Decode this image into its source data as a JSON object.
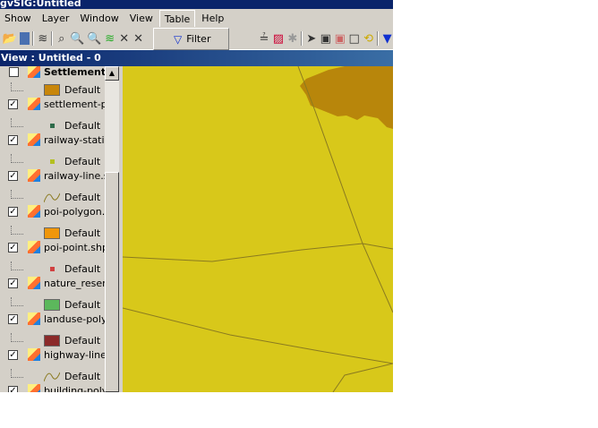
{
  "window": {
    "title": "gvSIG:Untitled"
  },
  "menu": [
    "Show",
    "Layer",
    "Window",
    "View",
    "Table",
    "Help"
  ],
  "dropdown": {
    "item": "Filter"
  },
  "view": {
    "title": "View : Untitled - 0"
  },
  "toc": {
    "top_partial": "Settlement",
    "legend_label": "Default",
    "layers": [
      {
        "name": "settlement-pc",
        "legend": "fill",
        "color": "#c8860a"
      },
      {
        "name": "railway-statio",
        "legend": "point",
        "color": "#2e6b4a"
      },
      {
        "name": "railway-line.sl",
        "legend": "point",
        "color": "#b4c020"
      },
      {
        "name": "poi-polygon.s",
        "legend": "line",
        "color": "#8a7a20"
      },
      {
        "name": "poi-point.shp",
        "legend": "fill",
        "color": "#f0960a"
      },
      {
        "name": "nature_reser",
        "legend": "point",
        "color": "#d04040"
      },
      {
        "name": "landuse-polyg",
        "legend": "fill",
        "color": "#5cb85c"
      },
      {
        "name": "highway-line.",
        "legend": "fill",
        "color": "#8b2a2a"
      },
      {
        "name": "building-polyc",
        "legend": "line",
        "color": "#8a7a20"
      }
    ]
  },
  "map": {
    "background": "#d8c81a",
    "polygon": "#b8860b",
    "line": "#8a7a20"
  }
}
